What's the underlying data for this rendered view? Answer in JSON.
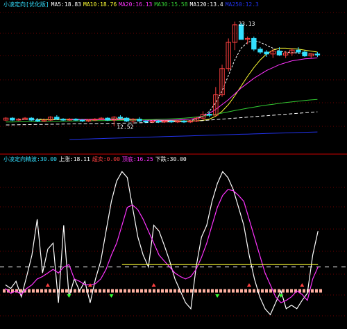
{
  "colors": {
    "bg": "#000000",
    "grid": "#9a0000",
    "divider": "#cc0000",
    "up": "#ff4040",
    "down": "#33e0ff",
    "white": "#ffffff",
    "yellow": "#ffff33",
    "magenta": "#ff33ff",
    "green": "#33cc33",
    "blue": "#2233ee",
    "salmon": "#ffb0a0",
    "lime": "#33ff33"
  },
  "upper_header": [
    {
      "text": "小凌定向[优化版]",
      "color": "#33e0ff"
    },
    {
      "text": "MA5:18.83",
      "color": "#ffffff"
    },
    {
      "text": "MA10:18.76",
      "color": "#ffff33"
    },
    {
      "text": "MA20:16.13",
      "color": "#ff33ff"
    },
    {
      "text": "MA30:15.58",
      "color": "#33cc33"
    },
    {
      "text": "MA120:13.4",
      "color": "#ffffff"
    },
    {
      "text": "MA250:12.3",
      "color": "#2233ee"
    }
  ],
  "lower_header": [
    {
      "text": "小凌定向精波:30.00",
      "color": "#33e0ff"
    },
    {
      "text": "上涨:18.11",
      "color": "#ffffff"
    },
    {
      "text": "超卖:0.00",
      "color": "#ff4040"
    },
    {
      "text": "顶底:16.25",
      "color": "#ff33ff"
    },
    {
      "text": "下跌:30.00",
      "color": "#ffffff"
    }
  ],
  "price_labels": [
    {
      "text": "23.13",
      "color": "#ffffff"
    },
    {
      "text": "12.52",
      "color": "#ffffff"
    }
  ],
  "chart_data": [
    {
      "type": "candlestick",
      "title": "小凌定向[优化版]",
      "grid": true,
      "ylim": [
        10,
        24.5
      ],
      "candles": [
        [
          13.0,
          13.3,
          12.9,
          13.2
        ],
        [
          13.2,
          13.3,
          12.9,
          13.0
        ],
        [
          13.0,
          13.2,
          12.9,
          13.1
        ],
        [
          13.1,
          13.3,
          13.0,
          13.2
        ],
        [
          13.2,
          13.3,
          12.9,
          13.0
        ],
        [
          13.0,
          13.2,
          12.8,
          12.9
        ],
        [
          12.9,
          13.1,
          12.8,
          13.0
        ],
        [
          13.0,
          13.4,
          12.9,
          13.3
        ],
        [
          13.3,
          13.5,
          13.0,
          13.1
        ],
        [
          13.1,
          13.2,
          12.9,
          13.0
        ],
        [
          13.0,
          13.2,
          12.9,
          13.1
        ],
        [
          13.1,
          13.2,
          12.9,
          13.0
        ],
        [
          13.0,
          13.1,
          12.8,
          12.9
        ],
        [
          12.9,
          13.1,
          12.8,
          13.0
        ],
        [
          13.0,
          13.2,
          12.9,
          13.1
        ],
        [
          13.1,
          13.3,
          13.0,
          13.2
        ],
        [
          13.2,
          13.3,
          12.9,
          13.0
        ],
        [
          13.0,
          13.4,
          12.4,
          13.3
        ],
        [
          13.3,
          13.5,
          13.1,
          13.2
        ],
        [
          13.2,
          13.3,
          12.8,
          12.9
        ],
        [
          12.9,
          13.2,
          12.6,
          13.1
        ],
        [
          13.1,
          13.3,
          12.8,
          12.9
        ],
        [
          12.9,
          13.0,
          12.7,
          12.8
        ],
        [
          12.8,
          13.0,
          12.7,
          12.9
        ],
        [
          12.9,
          13.0,
          12.7,
          12.8
        ],
        [
          12.8,
          13.0,
          12.7,
          12.9
        ],
        [
          12.9,
          13.0,
          12.7,
          12.8
        ],
        [
          12.8,
          13.0,
          12.7,
          12.9
        ],
        [
          12.9,
          13.0,
          12.7,
          12.8
        ],
        [
          12.8,
          13.0,
          12.7,
          12.9
        ],
        [
          12.9,
          13.3,
          12.8,
          13.2
        ],
        [
          13.2,
          13.9,
          13.0,
          13.6
        ],
        [
          13.6,
          13.9,
          13.3,
          13.5
        ],
        [
          13.5,
          16.4,
          13.5,
          15.6
        ],
        [
          15.6,
          18.7,
          15.4,
          18.3
        ],
        [
          18.3,
          21.4,
          18.0,
          21.0
        ],
        [
          21.0,
          23.13,
          20.2,
          22.8
        ],
        [
          22.8,
          23.0,
          21.7,
          21.3
        ],
        [
          21.3,
          21.6,
          20.8,
          21.4
        ],
        [
          21.4,
          21.6,
          20.1,
          20.3
        ],
        [
          20.3,
          20.5,
          19.8,
          20.0
        ],
        [
          20.0,
          20.2,
          19.5,
          19.8
        ],
        [
          19.8,
          20.3,
          19.4,
          20.1
        ],
        [
          20.1,
          20.5,
          19.6,
          19.7
        ],
        [
          19.7,
          20.1,
          19.4,
          19.9
        ],
        [
          19.9,
          20.4,
          19.6,
          20.2
        ],
        [
          20.2,
          20.5,
          19.8,
          20.0
        ],
        [
          20.0,
          20.2,
          19.5,
          19.6
        ],
        [
          19.6,
          19.9,
          19.4,
          19.8
        ],
        [
          19.8,
          20.0,
          19.5,
          19.7
        ]
      ],
      "series": [
        {
          "name": "MA5",
          "color": "#ffffff",
          "dash": "3,2",
          "start": 2,
          "values": [
            13.05,
            13.08,
            13.06,
            13.1,
            13.08,
            13.05,
            13.04,
            13.06,
            13.1,
            13.08,
            13.05,
            13.04,
            13.06,
            13.1,
            13.1,
            13.12,
            13.15,
            13.12,
            13.08,
            13.05,
            13.0,
            12.95,
            12.9,
            12.88,
            12.87,
            12.86,
            12.88,
            12.95,
            13.1,
            13.4,
            13.9,
            14.8,
            16.0,
            17.6,
            19.2,
            20.4,
            21.0,
            21.2,
            21.0,
            20.7,
            20.4,
            20.1,
            20.0,
            19.95,
            19.9,
            19.85,
            19.8,
            19.75
          ]
        },
        {
          "name": "MA10",
          "color": "#ffff33",
          "dash": "",
          "start": 5,
          "values": [
            13.05,
            13.06,
            13.06,
            13.07,
            13.07,
            13.06,
            13.05,
            13.06,
            13.07,
            13.08,
            13.08,
            13.09,
            13.1,
            13.1,
            13.1,
            13.08,
            13.05,
            13.02,
            13.0,
            12.98,
            12.95,
            12.93,
            12.92,
            12.91,
            12.9,
            12.92,
            12.97,
            13.1,
            13.4,
            13.9,
            14.6,
            15.5,
            16.5,
            17.5,
            18.4,
            19.2,
            19.8,
            20.2,
            20.4,
            20.4,
            20.35,
            20.3,
            20.2,
            20.1,
            20.0
          ]
        },
        {
          "name": "MA20",
          "color": "#ff33ff",
          "dash": "",
          "start": 10,
          "values": [
            13.05,
            13.06,
            13.06,
            13.06,
            13.06,
            13.06,
            13.05,
            13.05,
            13.04,
            13.03,
            13.02,
            13.01,
            13.0,
            12.99,
            12.99,
            12.99,
            13.0,
            13.02,
            13.05,
            13.1,
            13.2,
            13.4,
            13.7,
            14.1,
            14.6,
            15.1,
            15.7,
            16.3,
            16.8,
            17.3,
            17.7,
            18.1,
            18.4,
            18.7,
            18.9,
            19.1,
            19.2,
            19.3,
            19.35,
            19.4
          ]
        },
        {
          "name": "MA30",
          "color": "#33cc33",
          "dash": "",
          "start": 0,
          "values": [
            12.8,
            12.81,
            12.82,
            12.83,
            12.84,
            12.85,
            12.86,
            12.87,
            12.88,
            12.89,
            12.9,
            12.91,
            12.92,
            12.93,
            12.94,
            12.95,
            12.96,
            12.97,
            12.98,
            12.99,
            13.0,
            13.02,
            13.04,
            13.06,
            13.08,
            13.1,
            13.13,
            13.16,
            13.2,
            13.25,
            13.32,
            13.4,
            13.5,
            13.6,
            13.72,
            13.85,
            13.98,
            14.1,
            14.22,
            14.33,
            14.44,
            14.54,
            14.63,
            14.72,
            14.8,
            14.88,
            14.95,
            15.02,
            15.08,
            15.12
          ]
        },
        {
          "name": "MA120",
          "color": "#ffffff",
          "dash": "5,3",
          "start": 0,
          "values": [
            12.5,
            12.51,
            12.52,
            12.53,
            12.54,
            12.55,
            12.56,
            12.57,
            12.58,
            12.59,
            12.6,
            12.61,
            12.62,
            12.63,
            12.64,
            12.65,
            12.66,
            12.67,
            12.68,
            12.69,
            12.7,
            12.72,
            12.74,
            12.76,
            12.78,
            12.8,
            12.82,
            12.84,
            12.86,
            12.88,
            12.9,
            12.95,
            13.0,
            13.05,
            13.1,
            13.15,
            13.2,
            13.25,
            13.3,
            13.35,
            13.4,
            13.45,
            13.5,
            13.55,
            13.6,
            13.65,
            13.7,
            13.75,
            13.8,
            13.85
          ]
        },
        {
          "name": "MA250",
          "color": "#2233ee",
          "dash": "",
          "start": 10,
          "values": [
            11.0,
            11.02,
            11.04,
            11.06,
            11.08,
            11.1,
            11.12,
            11.14,
            11.16,
            11.18,
            11.2,
            11.22,
            11.24,
            11.26,
            11.28,
            11.3,
            11.32,
            11.34,
            11.36,
            11.38,
            11.4,
            11.42,
            11.44,
            11.46,
            11.48,
            11.5,
            11.52,
            11.54,
            11.56,
            11.58,
            11.6,
            11.62,
            11.64,
            11.66,
            11.68,
            11.7,
            11.72,
            11.74,
            11.76,
            11.78
          ]
        }
      ]
    },
    {
      "type": "line",
      "title": "小凌定向精波",
      "grid": true,
      "ylim": [
        -25,
        110
      ],
      "series": [
        {
          "name": "上涨",
          "color": "#ffffff",
          "dash": "",
          "values": [
            5,
            2,
            8,
            -5,
            12,
            30,
            60,
            15,
            35,
            40,
            -10,
            55,
            -5,
            10,
            0,
            8,
            -10,
            10,
            25,
            50,
            75,
            92,
            100,
            95,
            70,
            45,
            30,
            20,
            55,
            50,
            38,
            25,
            10,
            0,
            -10,
            -15,
            20,
            45,
            55,
            75,
            90,
            100,
            95,
            85,
            70,
            55,
            30,
            10,
            -5,
            -15,
            -20,
            -10,
            0,
            -15,
            -12,
            -15,
            -8,
            -2,
            30,
            50
          ]
        },
        {
          "name": "顶底",
          "color": "#ff33ff",
          "dash": "",
          "values": [
            2,
            -2,
            0,
            -3,
            2,
            5,
            10,
            12,
            15,
            18,
            15,
            20,
            22,
            10,
            8,
            5,
            5,
            6,
            10,
            18,
            30,
            40,
            55,
            70,
            72,
            68,
            60,
            50,
            40,
            30,
            25,
            20,
            15,
            12,
            10,
            12,
            18,
            28,
            40,
            55,
            70,
            80,
            85,
            84,
            80,
            75,
            60,
            45,
            30,
            15,
            5,
            -5,
            -10,
            -8,
            -5,
            0,
            -3,
            -8,
            10,
            20
          ]
        },
        {
          "name": "下跌",
          "color": "#ffff33",
          "dash": "",
          "values": [
            null,
            null,
            null,
            null,
            null,
            null,
            null,
            null,
            null,
            null,
            null,
            null,
            null,
            null,
            null,
            null,
            null,
            null,
            null,
            null,
            null,
            null,
            22,
            22,
            22,
            22,
            22,
            22,
            22,
            22,
            22,
            22,
            22,
            22,
            22,
            22,
            22,
            22,
            22,
            22,
            22,
            22,
            22,
            22,
            22,
            22,
            22,
            22,
            22,
            22,
            22,
            22,
            22,
            22,
            22,
            22,
            22,
            22,
            22,
            22
          ]
        }
      ],
      "reference_lines": [
        {
          "name": "超卖",
          "value": 0,
          "color": "#ffb0a0"
        },
        {
          "value": 20,
          "color": "#ffffff",
          "dash": "6,6"
        }
      ]
    }
  ]
}
